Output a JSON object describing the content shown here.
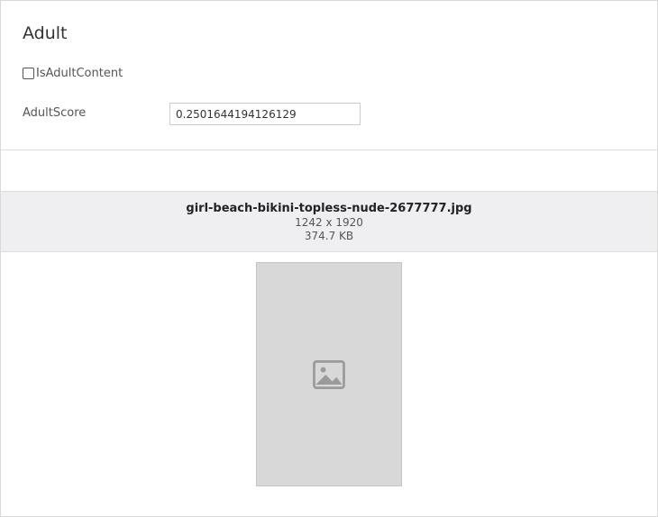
{
  "section": {
    "title": "Adult"
  },
  "is_adult_content": {
    "label": "IsAdultContent",
    "checked": false
  },
  "adult_score": {
    "label": "AdultScore",
    "value": "0.2501644194126129"
  },
  "file": {
    "name": "girl-beach-bikini-topless-nude-2677777.jpg",
    "dimensions": "1242 x 1920",
    "size": "374.7 KB"
  },
  "preview": {
    "icon": "image-icon"
  }
}
